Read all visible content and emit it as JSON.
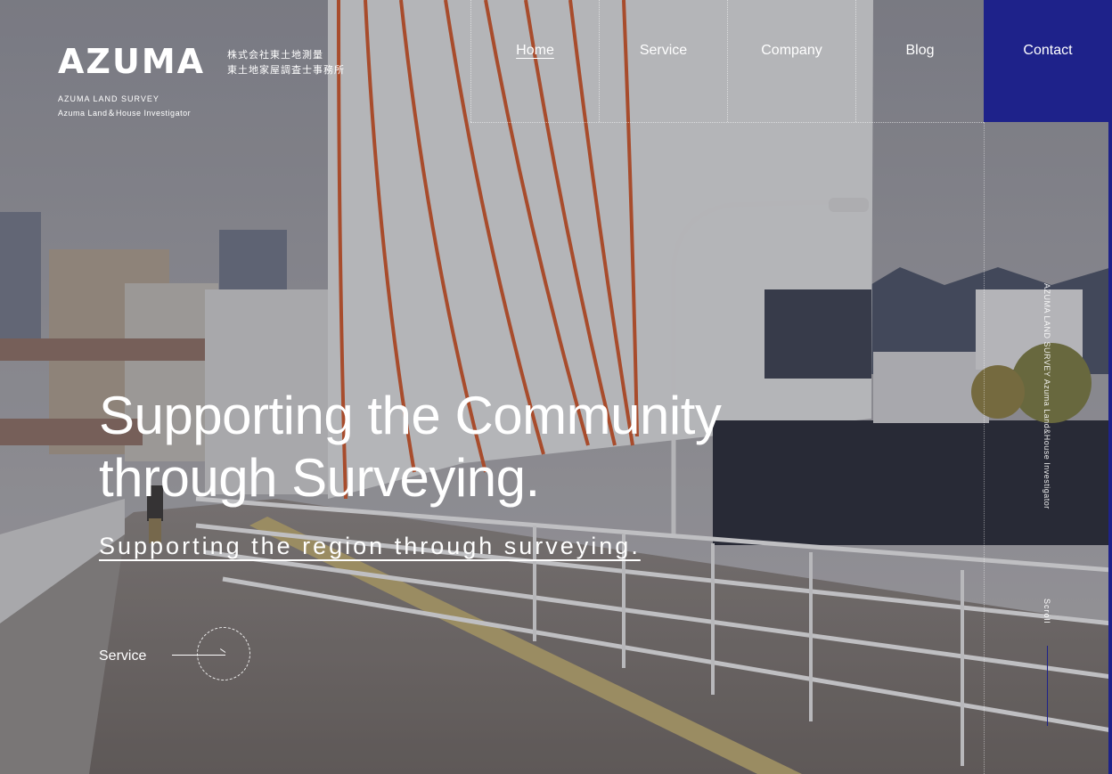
{
  "brand": {
    "logo": "AZUMA",
    "jp_line1": "株式会社東土地測量",
    "jp_line2": "東土地家屋調査士事務所",
    "sub_en1": "AZUMA LAND SURVEY",
    "sub_en2": "Azuma Land＆House Investigator"
  },
  "nav": {
    "items": [
      {
        "label": "Home",
        "active": true
      },
      {
        "label": "Service"
      },
      {
        "label": "Company"
      },
      {
        "label": "Blog"
      },
      {
        "label": "Contact"
      }
    ]
  },
  "hero": {
    "headline_line1": "Supporting the Community",
    "headline_line2": "through Surveying.",
    "tagline": "Supporting the region through surveying.",
    "cta_label": "Service",
    "vertical_text": "AZUMA LAND SURVEY Azuma Land&House Investigator",
    "scroll_label": "Scroll"
  },
  "colors": {
    "accent": "#1e228a",
    "text": "#ffffff"
  }
}
